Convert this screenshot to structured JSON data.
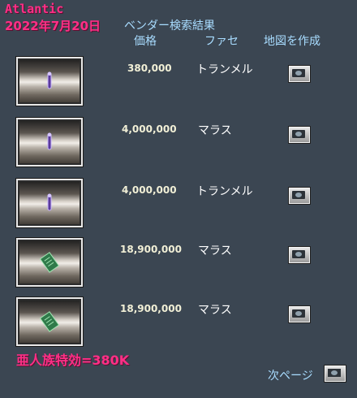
{
  "overlay": {
    "shard": "Atlantic",
    "date": "2022年7月20日",
    "note": "亜人族特効=380K"
  },
  "gump": {
    "title": "ベンダー検索結果",
    "columns": {
      "price": "価格",
      "shop": "ファセ",
      "map": "地図を作成"
    }
  },
  "results": [
    {
      "item_icon": "wand-icon",
      "price": "380,000",
      "facet": "トランメル"
    },
    {
      "item_icon": "wand-icon",
      "price": "4,000,000",
      "facet": "マラス"
    },
    {
      "item_icon": "wand-icon",
      "price": "4,000,000",
      "facet": "トランメル"
    },
    {
      "item_icon": "spellbook-icon",
      "price": "18,900,000",
      "facet": "マラス"
    },
    {
      "item_icon": "spellbook-icon",
      "price": "18,900,000",
      "facet": "マラス"
    }
  ],
  "pagination": {
    "next_label": "次ページ"
  },
  "colors": {
    "accent_pink": "#ff2f86",
    "header_blue": "#a8dcff",
    "background": "#3b4652"
  }
}
